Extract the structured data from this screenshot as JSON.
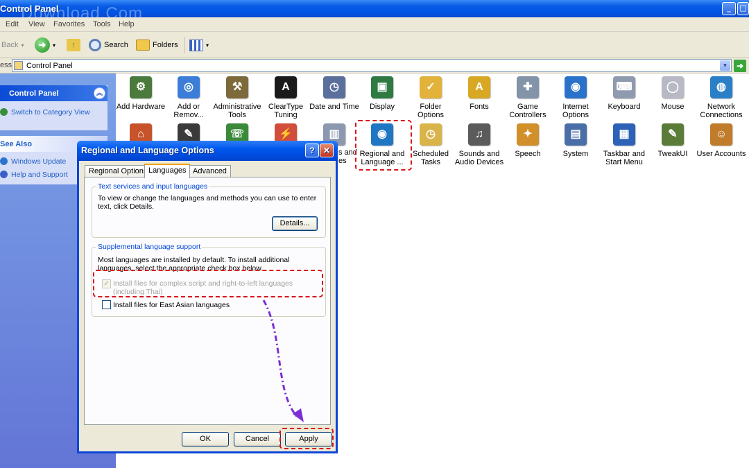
{
  "window": {
    "title": "Control Panel",
    "minimize": "_",
    "maximize": "□"
  },
  "watermark": "Download.Com",
  "menu": [
    "Edit",
    "View",
    "Favorites",
    "Tools",
    "Help"
  ],
  "toolbar": {
    "back": "Back",
    "search": "Search",
    "folders": "Folders",
    "dropdown": "▾"
  },
  "address": {
    "label": "ess",
    "value": "Control Panel",
    "go": "➜"
  },
  "taskpane": {
    "control_panel_header": "Control Panel",
    "switch_view": "Switch to Category View",
    "see_also_header": "See Also",
    "links": [
      "Windows Update",
      "Help and Support"
    ],
    "collapse_glyph": "︽"
  },
  "icons_row1": [
    {
      "label": "Add Hardware",
      "color": "#4a7a3c",
      "glyph": "⚙"
    },
    {
      "label": "Add or Remov...",
      "color": "#3b7dd8",
      "glyph": "◎"
    },
    {
      "label": "Administrative Tools",
      "color": "#7d6a3a",
      "glyph": "⚒"
    },
    {
      "label": "ClearType Tuning",
      "color": "#1a1a1a",
      "glyph": "A"
    },
    {
      "label": "Date and Time",
      "color": "#5a6f9c",
      "glyph": "◷"
    },
    {
      "label": "Display",
      "color": "#2f7a43",
      "glyph": "▣"
    },
    {
      "label": "Folder Options",
      "color": "#e2b23a",
      "glyph": "✓"
    },
    {
      "label": "Fonts",
      "color": "#d8a825",
      "glyph": "A"
    },
    {
      "label": "Game Controllers",
      "color": "#8393a8",
      "glyph": "✚"
    },
    {
      "label": "Internet Options",
      "color": "#2a72c9",
      "glyph": "◉"
    },
    {
      "label": "Keyboard",
      "color": "#8f9aae",
      "glyph": "⌨"
    },
    {
      "label": "Mouse",
      "color": "#b7bac4",
      "glyph": "◯"
    },
    {
      "label": "Network Connections",
      "color": "#2a7fc7",
      "glyph": "◍"
    }
  ],
  "icons_row2": [
    {
      "label": "Regional and Language ...",
      "color": "#1f77c4",
      "glyph": "◉"
    },
    {
      "label": "Scheduled Tasks",
      "color": "#d9b44a",
      "glyph": "◷"
    },
    {
      "label": "Sounds and Audio Devices",
      "color": "#5b5b5b",
      "glyph": "♫"
    },
    {
      "label": "Speech",
      "color": "#d1902a",
      "glyph": "✦"
    },
    {
      "label": "System",
      "color": "#4a6fa8",
      "glyph": "▤"
    },
    {
      "label": "Taskbar and Start Menu",
      "color": "#2d62b8",
      "glyph": "▦"
    },
    {
      "label": "TweakUI",
      "color": "#5a7c38",
      "glyph": "✎"
    },
    {
      "label": "User Accounts",
      "color": "#c07c2a",
      "glyph": "☺"
    }
  ],
  "partial_icons": {
    "label_a": "s and",
    "label_b": "es"
  },
  "dialog": {
    "title": "Regional and Language Options",
    "help_glyph": "?",
    "close_glyph": "✕",
    "tabs": [
      "Regional Options",
      "Languages",
      "Advanced"
    ],
    "text_services": {
      "title": "Text services and input languages",
      "description": "To view or change the languages and methods you can use to enter text, click Details.",
      "details_button": "Details..."
    },
    "supplemental": {
      "title": "Supplemental language support",
      "description": "Most languages are installed by default. To install additional languages, select the appropriate check box below.",
      "complex_script_label": "Install files for complex script and right-to-left languages (including Thai)",
      "complex_script_checked": true,
      "east_asian_label": "Install files for East Asian languages",
      "east_asian_checked": false,
      "check_glyph": "✓"
    },
    "buttons": {
      "ok": "OK",
      "cancel": "Cancel",
      "apply": "Apply"
    }
  },
  "colors": {
    "xp_blue": "#0054e3",
    "annotation_red": "#d8141b",
    "annotation_arrow": "#7b2fd6"
  }
}
